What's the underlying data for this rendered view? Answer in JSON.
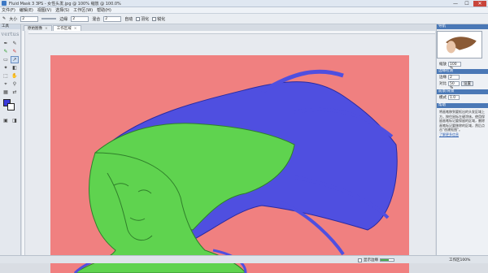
{
  "window": {
    "title": "Fluid Mask 3 3PS - 女性头发.jpg @ 100% 缩放 @ 100.0%",
    "min": "—",
    "max": "☐",
    "close": "✕"
  },
  "menu": [
    "文件(F)",
    "编辑(E)",
    "视图(V)",
    "选择(S)",
    "工作区(W)",
    "帮助(H)"
  ],
  "options": {
    "size_label": "大小",
    "size_value": "2",
    "edge_label": "边缘",
    "edge_value": "2",
    "blend_label": "混合",
    "blend_value": "2",
    "auto_label": "自动",
    "check1": "羽化",
    "check2": "锐化"
  },
  "toolbox": {
    "header": "工具",
    "logo": "vertus"
  },
  "tabs": [
    {
      "label": "原始图像"
    },
    {
      "label": "工作区域",
      "active": true
    }
  ],
  "panel": {
    "header": "导航",
    "zoom_label": "缩放",
    "zoom_value": "100 %",
    "section1": "边缘检测",
    "row1_label": "边缘",
    "row1_value": "2",
    "row2_label": "对比",
    "row2_value": "50 %",
    "row2_btn": "设置",
    "section2": "前景/背景",
    "row3_label": "模式",
    "row3_value": "1.0",
    "section3": "帮助",
    "help_text": "将画笔移到要抠出的头发区域上方，按住鼠标左键涂抹。使用保留画笔标记要保留的区域，删除画笔标记要移除的区域，然后点击“创建抠图”。",
    "help_link": "了解更多信息"
  },
  "status": {
    "show_label": "显示边缘",
    "progress_pct": 60,
    "right_label": "工作区100%"
  },
  "colors": {
    "fg": "#3a3adb",
    "bg": "#ffffff",
    "keep": "#5fd34f",
    "remove": "#4f4fe0",
    "canvas": "#f08080"
  }
}
